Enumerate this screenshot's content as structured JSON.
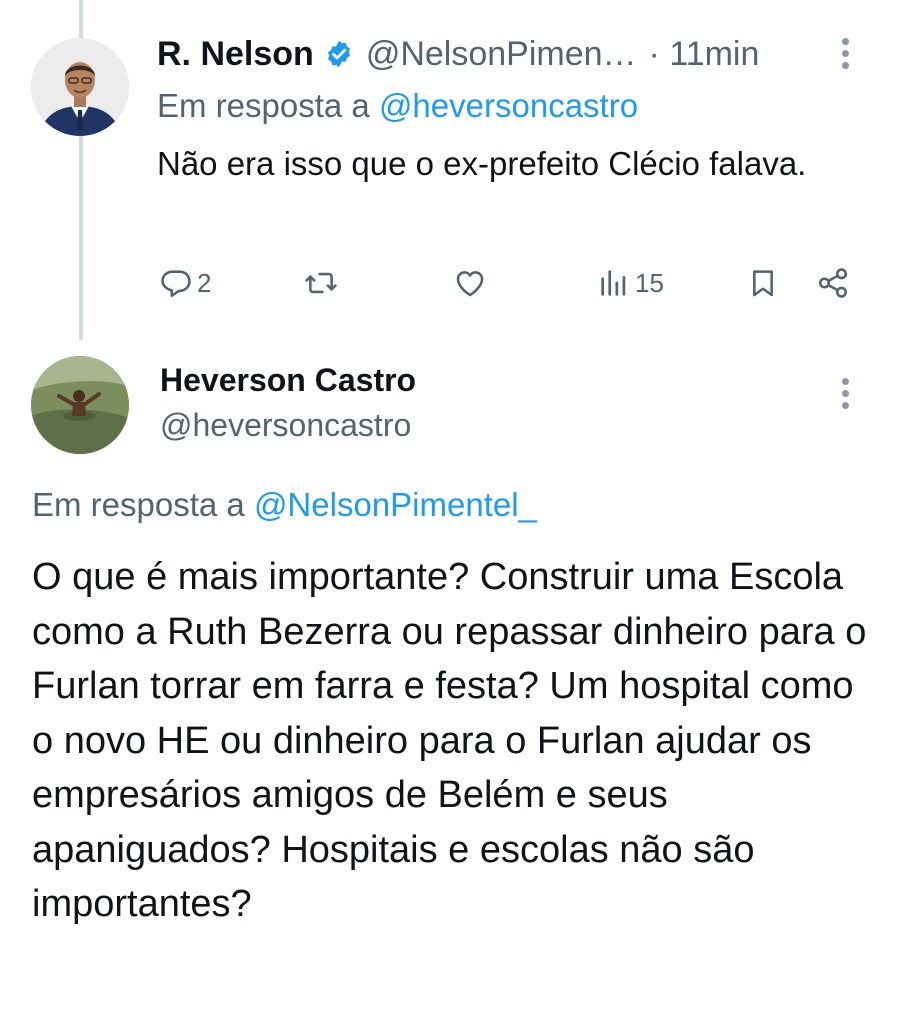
{
  "reply_tweet": {
    "author_name": "R. Nelson",
    "author_handle": "@NelsonPimen…",
    "time": "· 11min",
    "reply_to_prefix": "Em resposta a",
    "reply_to_handle": "@heversoncastro",
    "text": "Não era isso que o ex-prefeito Clécio falava.",
    "actions": {
      "reply_count": "2",
      "retweet_count": "",
      "like_count": "",
      "views_count": "15"
    },
    "icons": {
      "verified": "verified-badge-icon",
      "reply": "reply-icon",
      "retweet": "retweet-icon",
      "like": "heart-icon",
      "views": "views-icon",
      "bookmark": "bookmark-icon",
      "share": "share-icon",
      "more": "more-vertical-icon"
    }
  },
  "main_tweet": {
    "author_name": "Heverson Castro",
    "author_handle": "@heversoncastro",
    "reply_to_prefix": "Em resposta a",
    "reply_to_handle": "@NelsonPimentel_",
    "text": "O que é mais importante? Construir uma Escola como a Ruth Bezerra ou repassar dinheiro para o Furlan torrar em farra e festa? Um hospital como o novo HE ou dinheiro para o Furlan ajudar os empresários amigos de Belém e seus apaniguados? Hospitais e escolas não são importantes?"
  },
  "colors": {
    "text_primary": "#0f1419",
    "text_secondary": "#536471",
    "link": "#1d9bf0",
    "verified": "#1d9bf0",
    "thread_line": "#cfd9de"
  }
}
